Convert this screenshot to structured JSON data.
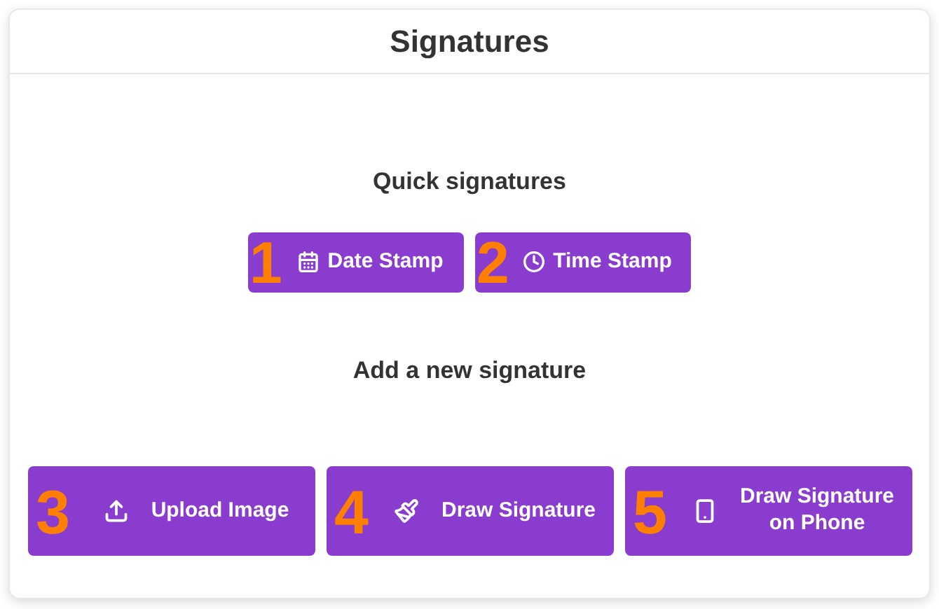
{
  "header": {
    "title": "Signatures"
  },
  "quick": {
    "heading": "Quick signatures",
    "buttons": [
      {
        "kind": "date",
        "label": "Date Stamp",
        "marker": "1"
      },
      {
        "kind": "time",
        "label": "Time Stamp",
        "marker": "2"
      }
    ]
  },
  "add": {
    "heading": "Add a new signature",
    "buttons": [
      {
        "kind": "upload",
        "label": "Upload Image",
        "marker": "3"
      },
      {
        "kind": "draw",
        "label": "Draw Signature",
        "marker": "4"
      },
      {
        "kind": "phone",
        "label": "Draw Signature on Phone",
        "marker": "5"
      }
    ]
  }
}
